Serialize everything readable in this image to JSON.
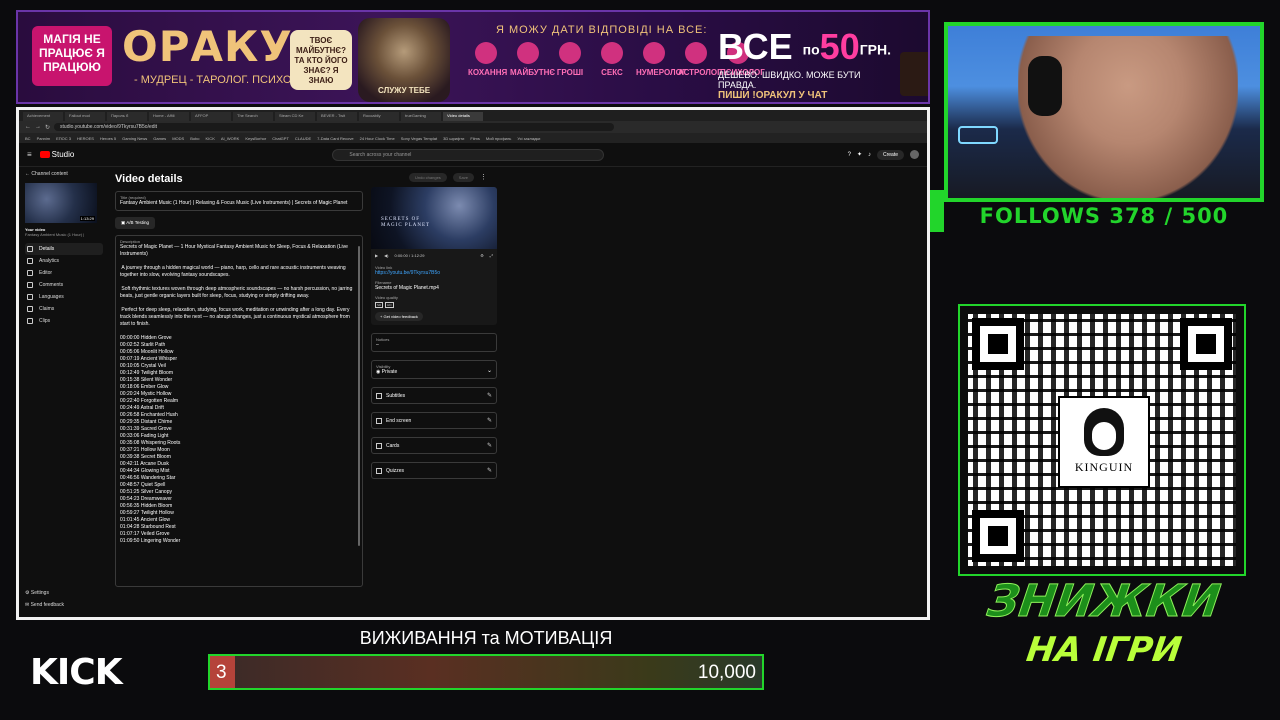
{
  "banner": {
    "magic_badge": "МАГІЯ НЕ ПРАЦЮЄ Я ПРАЦЮЮ",
    "title": "ОРАКУЛ",
    "subtitle": "- МУДРЕЦ - ТАРОЛОГ. ПСИХОЛОГ. -",
    "speech": "ТВОЄ МАЙБУТНЄ? ТА КТО ЙОГО ЗНАЄ? Я ЗНАЮ",
    "wizard_caption": "СЛУЖУ ТЕБЕ",
    "headline": "Я МОЖУ ДАТИ ВІДПОВІДІ НА ВСЕ:",
    "categories": [
      "КОХАННЯ",
      "МАЙБУТНЄ",
      "ГРОШІ",
      "СЕКС",
      "НУМЕРОЛОГ",
      "АСТРОЛОГ",
      "ПСИХОЛОГ"
    ],
    "price_prefix": "ВСЕ",
    "price_mid": "по",
    "price_num": "50",
    "price_cur": "ГРН.",
    "price_sub": "ДЕШЕВО. ШВИДКО. МОЖЕ БУТИ ПРАВДА.",
    "price_cta": "ПИШИ !ОРАКУЛ У ЧАТ"
  },
  "follows": "FOLLOWS 378 / 500",
  "qr": {
    "brand": "KINGUIN"
  },
  "discount": {
    "line1": "ЗНИЖКИ",
    "line2": "НА ІГРИ"
  },
  "kick": "KICK",
  "goal": {
    "title": "ВИЖИВАННЯ та МОТИВАЦІЯ",
    "current": "3",
    "max": "10,000",
    "progress_fraction": 0.0003
  },
  "browser": {
    "tabs": [
      "Achievement",
      "Fallout mod",
      "Пароль б",
      "Home - Affili",
      "AFFOP",
      "The Search",
      "Steam CD Ke",
      "BEVER - Twit",
      "Rocoabily",
      "trueGaming",
      "Video details"
    ],
    "url": "studio.youtube.com/video/9Tkyrsu7B5o/edit",
    "bookmarks": [
      "BC",
      "Pannim",
      "ЕПОС 3",
      "HEROES",
      "Heroes 5",
      "Gaming News",
      "Games",
      "MODS",
      "Bobo",
      "KICK",
      "AI_WORK",
      "KeysBorhor",
      "ChatGPT",
      "CLAUDE",
      "7-Data Card Recove",
      "24 Hour Clock Time",
      "Sony Vegas Templat",
      "3D шрифти",
      "Films",
      "Мой профиль",
      "Усі закладки"
    ]
  },
  "studio": {
    "logo": "Studio",
    "search_placeholder": "Search across your channel",
    "create": "Create",
    "back": "Channel content",
    "thumb_duration": "1:13:29",
    "your_video": "Your video",
    "your_video_title": "Fantasy Ambient Music (1 Hour) |",
    "nav": [
      "Details",
      "Analytics",
      "Editor",
      "Comments",
      "Languages",
      "Claims",
      "Clips"
    ],
    "settings": "Settings",
    "send_feedback": "Send feedback",
    "page_title": "Video details",
    "undo": "Undo changes",
    "save": "Save",
    "title_label": "Title (required)",
    "title_value": "Fantasy Ambient Music (1 Hour) | Relaxing & Focus Music (Live Instruments) | Secrets of Magic Planet",
    "ab_testing": "A/B Testing",
    "desc_label": "Description",
    "description": "Secrets of Magic Planet — 1 Hour Mystical Fantasy Ambient Music for Sleep, Focus & Relaxation (Live Instruments)\n\n A journey through a hidden magical world — piano, harp, cello and rare acoustic instruments weaving together into slow, evolving fantasy soundscapes.\n\n Soft rhythmic textures woven through deep atmospheric soundscapes — no harsh percussion, no jarring beats, just gentle organic layers built for sleep, focus, studying or simply drifting away.\n\n Perfect for deep sleep, relaxation, studying, focus work, meditation or unwinding after a long day. Every track blends seamlessly into the next — no abrupt changes, just a continuous mystical atmosphere from start to finish.\n\n00:00:00 Hidden Grove\n00:02:52 Starlit Path\n00:05:06 Moonlit Hollow\n00:07:19 Ancient Whisper\n00:10:05 Crystal Veil\n00:12:49 Twilight Bloom\n00:15:38 Silent Wonder\n00:18:06 Ember Glow\n00:20:24 Mystic Hollow\n00:22:40 Forgotten Realm\n00:24:49 Astral Drift\n00:26:58 Enchanted Hush\n00:29:35 Distant Chime\n00:31:39 Sacred Grove\n00:33:06 Fading Light\n00:35:08 Whispering Roots\n00:37:21 Hollow Moon\n00:39:38 Secret Bloom\n00:42:11 Arcane Dusk\n00:44:34 Glowing Mist\n00:46:56 Wandering Star\n00:48:57 Quiet Spell\n00:51:25 Silver Canopy\n00:54:23 Dreamweaver\n00:56:35 Hidden Bloom\n00:59:27 Twilight Hollow\n01:01:45 Ancient Glow\n01:04:28 Starbound Rest\n01:07:17 Veiled Grove\n01:09:50 Lingering Wonder",
    "player_caption": "SECRETS OF\nMAGIC PLANET",
    "player_time": "0:00:00 / 1:12:29",
    "video_link_label": "Video link",
    "video_link": "https://youtu.be/9Tkyrsu7B5o",
    "filename_label": "Filename",
    "filename": "Secrets of Magic Planet.mp4",
    "quality_label": "Video quality",
    "quality_badges": [
      "SD",
      "HD"
    ],
    "feedback": "Get video feedback",
    "notices_label": "Notices",
    "notices_value": "–",
    "visibility_label": "Visibility",
    "visibility_value": "Private",
    "rows": [
      "Subtitles",
      "End screen",
      "Cards",
      "Quizzes"
    ]
  }
}
